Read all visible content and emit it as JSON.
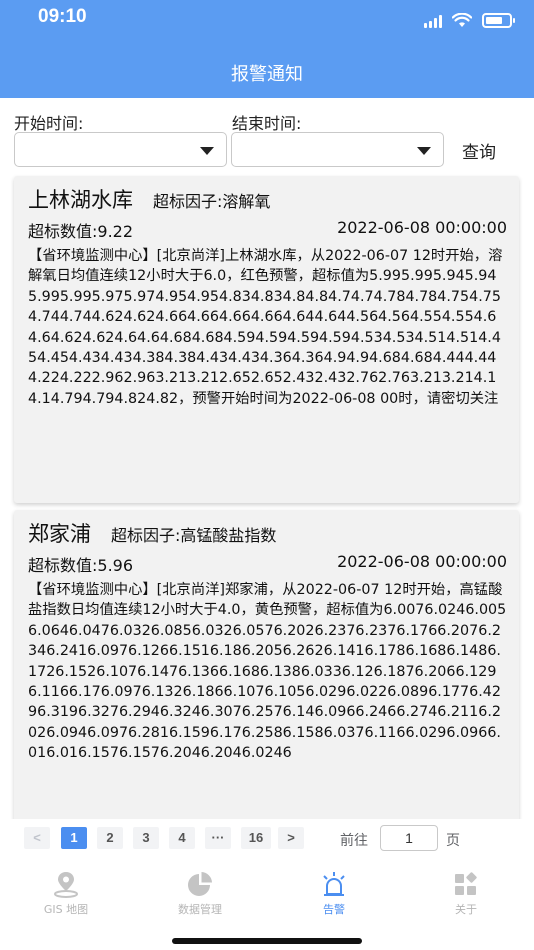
{
  "status": {
    "time": "09:10"
  },
  "nav": {
    "title": "报警通知"
  },
  "filters": {
    "start_label": "开始时间:",
    "end_label": "结束时间:",
    "start_value": "",
    "end_value": "",
    "query_label": "查询"
  },
  "alarms": [
    {
      "name": "上林湖水库",
      "factor": "超标因子:溶解氧",
      "value": "超标数值:9.22",
      "time": "2022-06-08 00:00:00",
      "body": "【省环境监测中心】[北京尚洋]上林湖水库，从2022-06-07 12时开始，溶解氧日均值连续12小时大于6.0，红色预警，超标值为5.995.995.945.945.995.995.975.974.954.954.834.834.84.84.74.74.784.784.754.754.744.744.624.624.664.664.664.664.644.644.564.564.554.554.64.64.624.624.64.64.684.684.594.594.594.594.534.534.514.514.454.454.434.434.384.384.434.434.364.364.94.94.684.684.444.444.224.222.962.963.213.212.652.652.432.432.762.763.213.214.14.14.794.794.824.82，预警开始时间为2022-06-08 00时，请密切关注"
    },
    {
      "name": "郑家浦",
      "factor": "超标因子:高锰酸盐指数",
      "value": "超标数值:5.96",
      "time": "2022-06-08 00:00:00",
      "body": "【省环境监测中心】[北京尚洋]郑家浦，从2022-06-07 12时开始，高锰酸盐指数日均值连续12小时大于4.0，黄色预警，超标值为6.0076.0246.0056.0646.0476.0326.0856.0326.0576.2026.2376.2376.1766.2076.2346.2416.0976.1266.1516.186.2056.2626.1416.1786.1686.1486.1726.1526.1076.1476.1366.1686.1386.0336.126.1876.2066.1296.1166.176.0976.1326.1866.1076.1056.0296.0226.0896.1776.4296.3196.3276.2946.3246.3076.2576.146.0966.2466.2746.2116.2026.0946.0976.2816.1596.176.2586.1586.0376.1166.0296.0966.016.016.1576.1576.2046.2046.0246"
    }
  ],
  "pagination": {
    "prev": "<",
    "pages": [
      "1",
      "2",
      "3",
      "4",
      "···",
      "16"
    ],
    "active": "1",
    "next": ">",
    "goto_label": "前往",
    "goto_value": "1",
    "goto_suffix": "页"
  },
  "tabs": [
    {
      "label": "GIS 地图",
      "icon": "map-pin-icon"
    },
    {
      "label": "数据管理",
      "icon": "pie-chart-icon"
    },
    {
      "label": "告警",
      "icon": "alarm-light-icon",
      "active": true
    },
    {
      "label": "关于",
      "icon": "grid-apps-icon"
    }
  ],
  "colors": {
    "primary": "#5b9cf2",
    "accent": "#4b8ef0",
    "card_bg": "#f2f2f2"
  }
}
